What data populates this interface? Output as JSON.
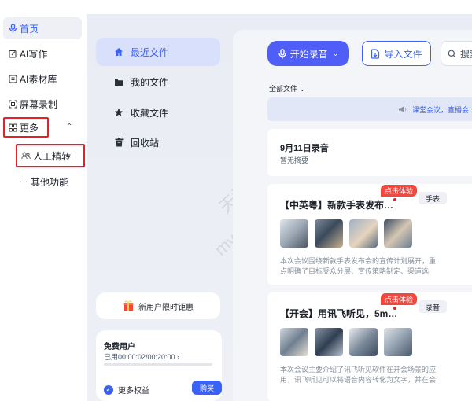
{
  "left_nav": {
    "home": "首页",
    "ai_write": "AI写作",
    "ai_library": "AI素材库",
    "screen_record": "屏幕录制",
    "more": "更多",
    "manual_refine": "人工精转",
    "other_features": "其他功能"
  },
  "sidebar": {
    "recent": "最近文件",
    "my_files": "我的文件",
    "favorites": "收藏文件",
    "recycle_bin": "回收站"
  },
  "watermark": {
    "line1": "天极下载站",
    "line2": "mydown.yesky.com"
  },
  "promo": {
    "label": "新用户限时钜惠"
  },
  "user": {
    "plan": "免费用户",
    "usage": "已用00:00:02/00:20:00 ›",
    "usage_fraction": 0.0017,
    "benefits": "更多权益",
    "buy": "购买"
  },
  "toolbar": {
    "record": "开始录音",
    "import": "导入文件",
    "search_placeholder": "搜索"
  },
  "filter": {
    "label": "全部文件 ⌄"
  },
  "banner": {
    "text": "课堂会议，直播会"
  },
  "date_card": {
    "title": "9月11日录音",
    "subtitle": "暂无摘要"
  },
  "cards": [
    {
      "title": "【中英粤】新款手表发布…",
      "badge": "点击体验",
      "tag": "手表",
      "summary_line1": "本次会议围绕新款手表发布会的宣传计划展开，重",
      "summary_line2": "点明确了目标受众分层、宣传策略制定、渠道选"
    },
    {
      "title": "【开会】用讯飞听见，5m…",
      "badge": "点击体验",
      "tag": "录音",
      "summary_line1": "本次会议主要介绍了讯飞听见软件在开会场景的应",
      "summary_line2": "用，讯飞听见可以将语音内容转化为文字，并在会"
    }
  ],
  "colors": {
    "accent": "#3a63f5",
    "highlight_red": "#e5202b",
    "record_button": "#4f5ef6"
  }
}
